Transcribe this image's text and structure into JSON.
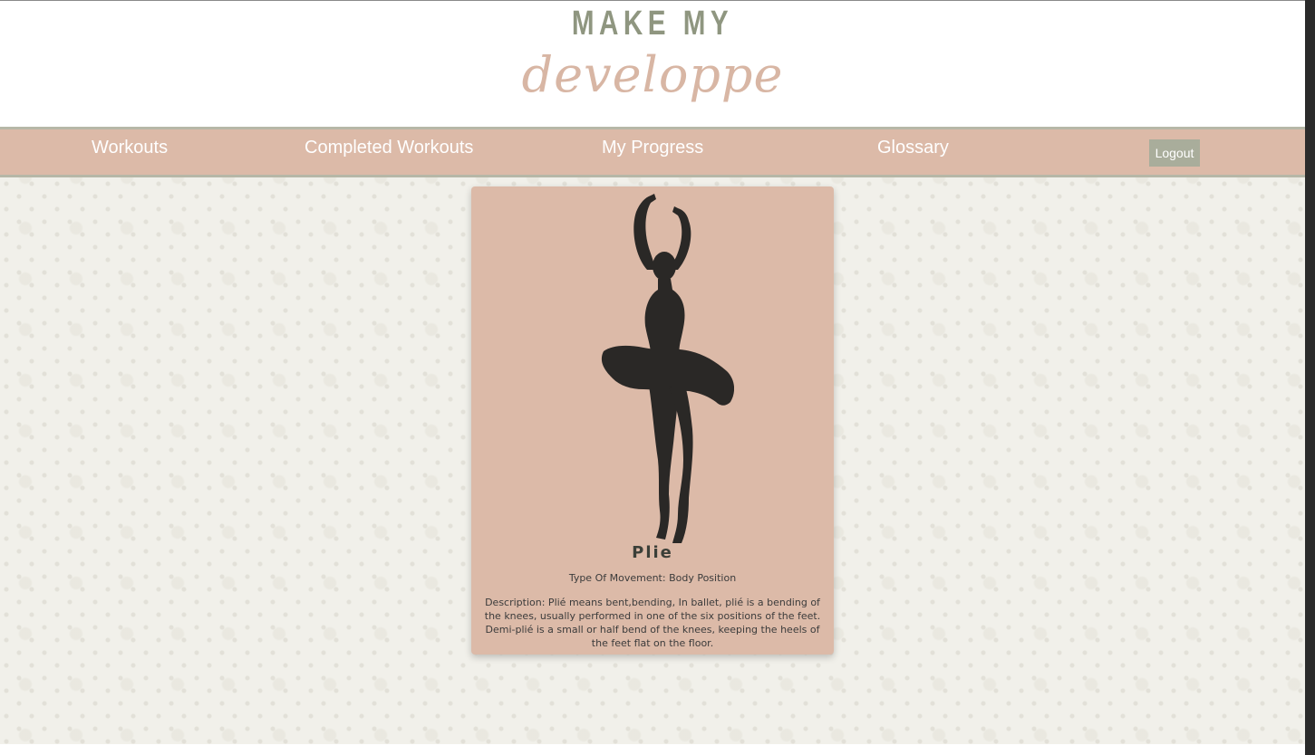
{
  "brand": {
    "line1": "MAKE MY",
    "line2": "developpe"
  },
  "nav": {
    "items": [
      {
        "label": "Workouts"
      },
      {
        "label": "Completed Workouts"
      },
      {
        "label": "My Progress"
      },
      {
        "label": "Glossary"
      }
    ],
    "logout_label": "Logout"
  },
  "card": {
    "image_icon": "ballerina-silhouette-icon",
    "title": "Plie",
    "type": "Type Of Movement: Body Position",
    "description": "Description: Plié means bent,bending, In ballet, plié is a bending of the knees, usually performed in one of the six positions of the feet. Demi-plié is a small or half bend of the knees, keeping the heels of the feet flat on the floor."
  },
  "colors": {
    "nav_bg": "#dcbaa8",
    "nav_border": "#b6b7a7",
    "logout_bg": "#a9ad9b",
    "logo_green": "#8f9680",
    "logo_pink": "#d8b6a4",
    "silhouette": "#2a2826"
  }
}
